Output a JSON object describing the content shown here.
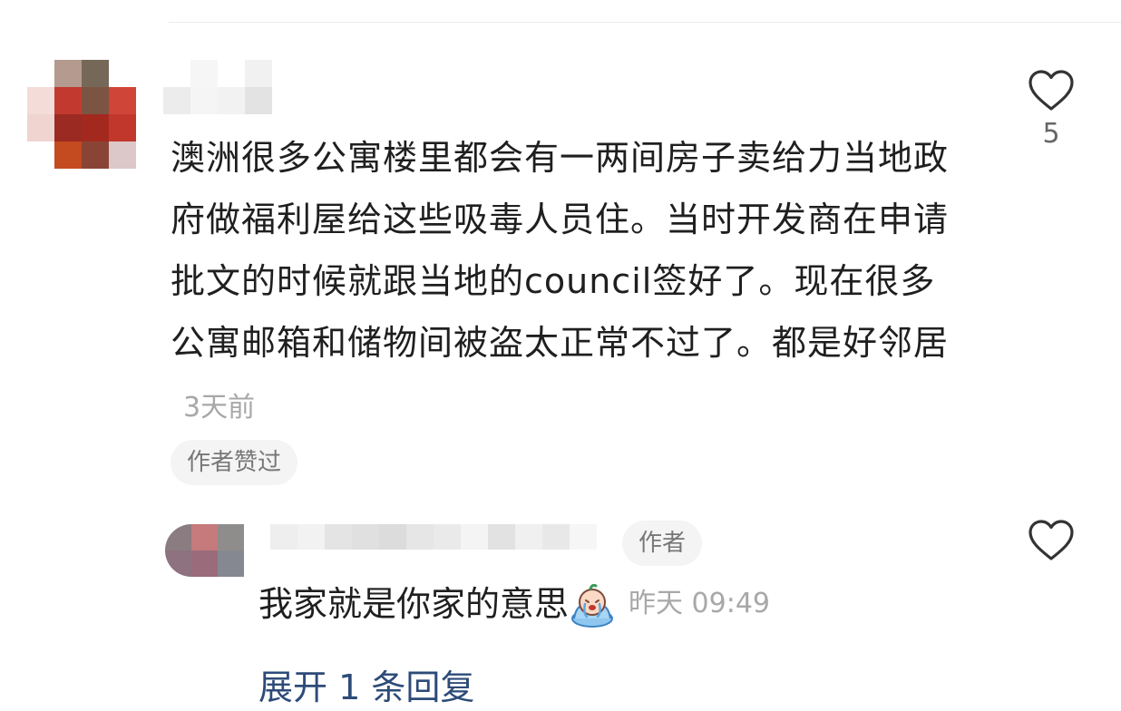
{
  "comment": {
    "text": "澳洲很多公寓楼里都会有一两间房子卖给力当地政府做福利屋给这些吸毒人员住。当时开发商在申请批文的时候就跟当地的council签好了。现在很多公寓邮箱和储物间被盗太正常不过了。都是好邻居",
    "time": "3天前",
    "author_liked_label": "作者赞过",
    "like_count": "5",
    "like_icon": "heart-outline-icon"
  },
  "reply": {
    "author_tag": "作者",
    "text": "我家就是你家的意思",
    "emoji_icon": "crying-emoji-icon",
    "time": "昨天 09:49",
    "like_icon": "heart-outline-icon"
  },
  "expand_label": "展开 1 条回复",
  "colors": {
    "text": "#1f1f1f",
    "muted": "#a8a8a8",
    "link": "#2d4b78",
    "chip_bg": "#f4f4f4"
  }
}
